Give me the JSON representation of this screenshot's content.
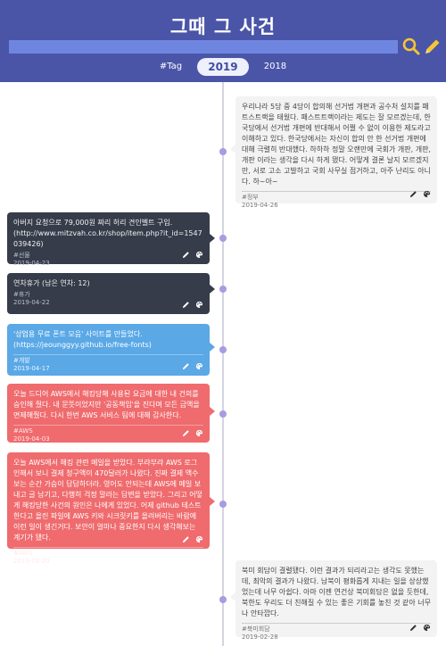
{
  "header": {
    "title": "그때 그 사건",
    "search_value": "",
    "tabs": [
      {
        "label": "#Tag"
      },
      {
        "label": "2019"
      },
      {
        "label": "2018"
      }
    ]
  },
  "posts": [
    {
      "text": "우리나라 5당 중 4당이 합의해 선거법 개편과 공수처 설치를 패트스트랙을 태웠다. 패스트트랙이라는 제도는 잘 모르겠는데, 한국당에서 선거법 개편에 반대해서 어쩔 수 없이 이용한 제도라고 이해하고 있다. 한국당에서는 자신이 합의 안 한 선거법 개편에 대해 극렬히 반대했다. 하하하 정말 오랜만에 국회가 개판, 개판, 개판 이라는 생각을 다시 하게 됐다. 어떻게 결론 날지 모르겠지만, 서로 고소 고발하고 국회 사무실 점거하고, 아주 난리도 아니다. 하~아~",
      "tag": "#정부",
      "date": "2019-04-26",
      "style": "light"
    },
    {
      "text": "아버지 요청으로 79,000원 짜리 허리 견인벨트 구입.\n(http://www.mitzvah.co.kr/shop/item.php?it_id=1547039426)",
      "tag": "#선물",
      "date": "2019-04-23",
      "style": "dark"
    },
    {
      "text": "연차휴가 (남은 연차: 12)",
      "tag": "#휴가",
      "date": "2019-04-22",
      "style": "dark"
    },
    {
      "text": "'상업용 무료 폰트 모음' 사이트를 만들었다.\n(https://jeounggyy.github.io/free-fonts)",
      "tag": "#개발",
      "date": "2019-04-17",
      "style": "blue"
    },
    {
      "text": "오늘 드디어 AWS에서 해킹당해 사용된 요금에 대한 내 건의를 승인해 줬다. 내 문뜻이었지만 '공동책임'을 진다며 모든 금액을 면제해줬다. 다시 한번 AWS 서비스 팀에 대해 감사한다.",
      "tag": "#AWS",
      "date": "2019-04-03",
      "style": "red"
    },
    {
      "text": "오늘 AWS에서 해킹 관련 메일을 받았다. 부랴부랴 AWS 로그인해서 보니 결제 청구액이 470달러가 나왔다. 진짜 결제 액수 보는 순간 가슴이 답답하더라. 영어도 안되는데 AWS에 메일 보내고 글 남기고, 다행히 걱정 말라는 답변을 받았다. 그리고 어떻게 해킹당한 사건의 원인은 나에게 있었다. 어제 github 테스트한다고 올린 파일에 AWS 키와 시크릿키를 올려버리는 바람에 이런 일이 생긴거다. 보안이 얼마나 중요한지 다시 생각해보는 계기가 됐다.",
      "tag": "#AWS",
      "date": "2019-03-20",
      "style": "red"
    },
    {
      "text": "북미 회담이 결렬됐다. 이런 결과가 되리라고는 생각도 못했는데, 최악의 결과가 나왔다. 남북이 평화롭게 지내는 일을 상상했었는데 너무 아쉽다. 아마 이젠 연건상 북미회담은 없을 듯한데, 북한도 우리도 더 친해질 수 있는 좋은 기회를 놓친 것 같아 너무나 안타깝다.",
      "tag": "#북미회담",
      "date": "2019-02-28",
      "style": "light"
    }
  ],
  "colors": {
    "header": "#4a55a8",
    "search_bar": "#6f86e0",
    "accent_yellow": "#f6c533",
    "timeline_dot": "#a89be0",
    "card_dark": "#363c4a",
    "card_blue": "#5aa8e6",
    "card_red": "#ef6b6e",
    "card_light": "#f3f3f3"
  },
  "icons": {
    "search": "search-icon",
    "write": "pencil-icon",
    "edit": "pencil-icon",
    "palette": "palette-icon"
  }
}
